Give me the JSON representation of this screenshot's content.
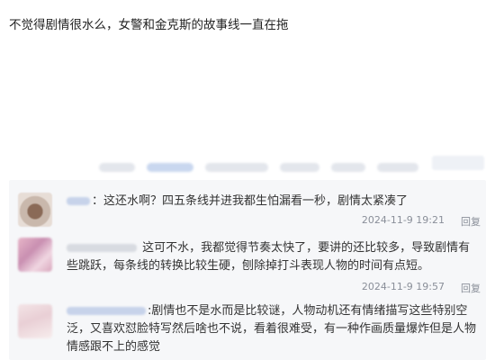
{
  "post": {
    "text": "不觉得剧情很水么，女警和金克斯的故事线一直在拖"
  },
  "comments": [
    {
      "text": "：这还水啊？四五条线并进我都生怕漏看一秒，剧情太紧凑了",
      "time": "2024-11-9 19:21",
      "reply_label": "回复"
    },
    {
      "text": "这可不水，我都觉得节奏太快了，要讲的还比较多，导致剧情有些跳跃，每条线的转换比较生硬，刨除掉打斗表现人物的时间有点短。",
      "time": "2024-11-9 19:57",
      "reply_label": "回复"
    },
    {
      "text": ":剧情也不是水而是比较谜，人物动机还有情绪描写这些特别空泛，又喜欢怼脸特写然后啥也不说，看着很难受，有一种作画质量爆炸但是人物情感跟不上的感觉"
    }
  ]
}
